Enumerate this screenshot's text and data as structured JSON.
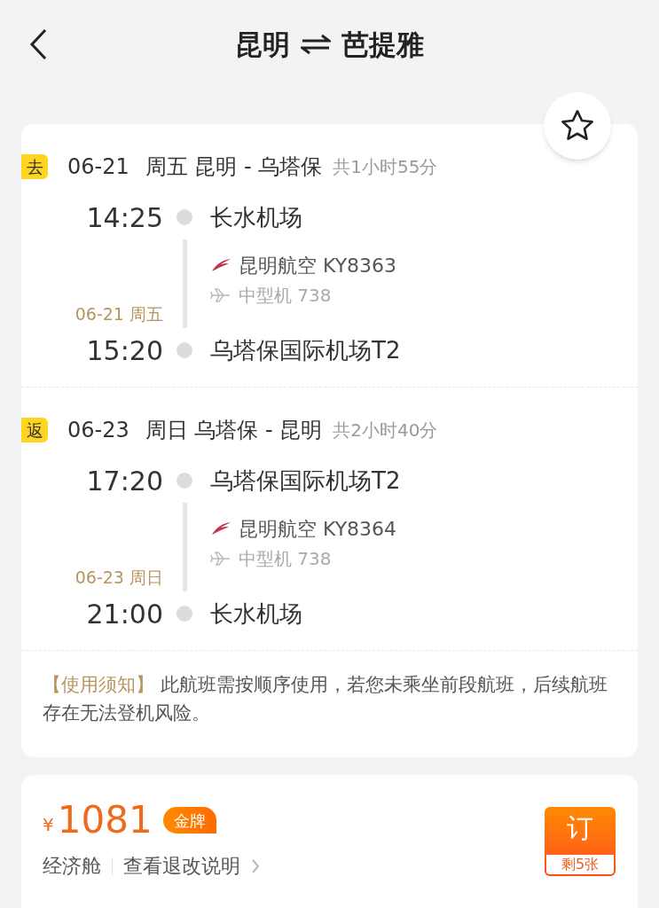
{
  "header": {
    "from": "昆明",
    "to": "芭提雅"
  },
  "favorite": {
    "on": false
  },
  "segments": [
    {
      "tag": "去",
      "date": "06-21",
      "weekday": "周五",
      "route": "昆明 - 乌塔保",
      "duration": "共1小时55分",
      "dep_time": "14:25",
      "dep_airport": "长水机场",
      "airline": "昆明航空 KY8363",
      "aircraft": "中型机 738",
      "arr_date": "06-21 周五",
      "arr_time": "15:20",
      "arr_airport": "乌塔保国际机场T2"
    },
    {
      "tag": "返",
      "date": "06-23",
      "weekday": "周日",
      "route": "乌塔保 - 昆明",
      "duration": "共2小时40分",
      "dep_time": "17:20",
      "dep_airport": "乌塔保国际机场T2",
      "airline": "昆明航空 KY8364",
      "aircraft": "中型机 738",
      "arr_date": "06-23 周日",
      "arr_time": "21:00",
      "arr_airport": "长水机场"
    }
  ],
  "notice": {
    "label": "【使用须知】",
    "text": "此航班需按顺序使用，若您未乘坐前段航班，后续航班存在无法登机风险。"
  },
  "fare": {
    "currency": "¥",
    "price": "1081",
    "badge": "金牌",
    "cabin": "经济舱",
    "rules_link": "查看退改说明",
    "book": "订",
    "remaining": "剩5张"
  }
}
